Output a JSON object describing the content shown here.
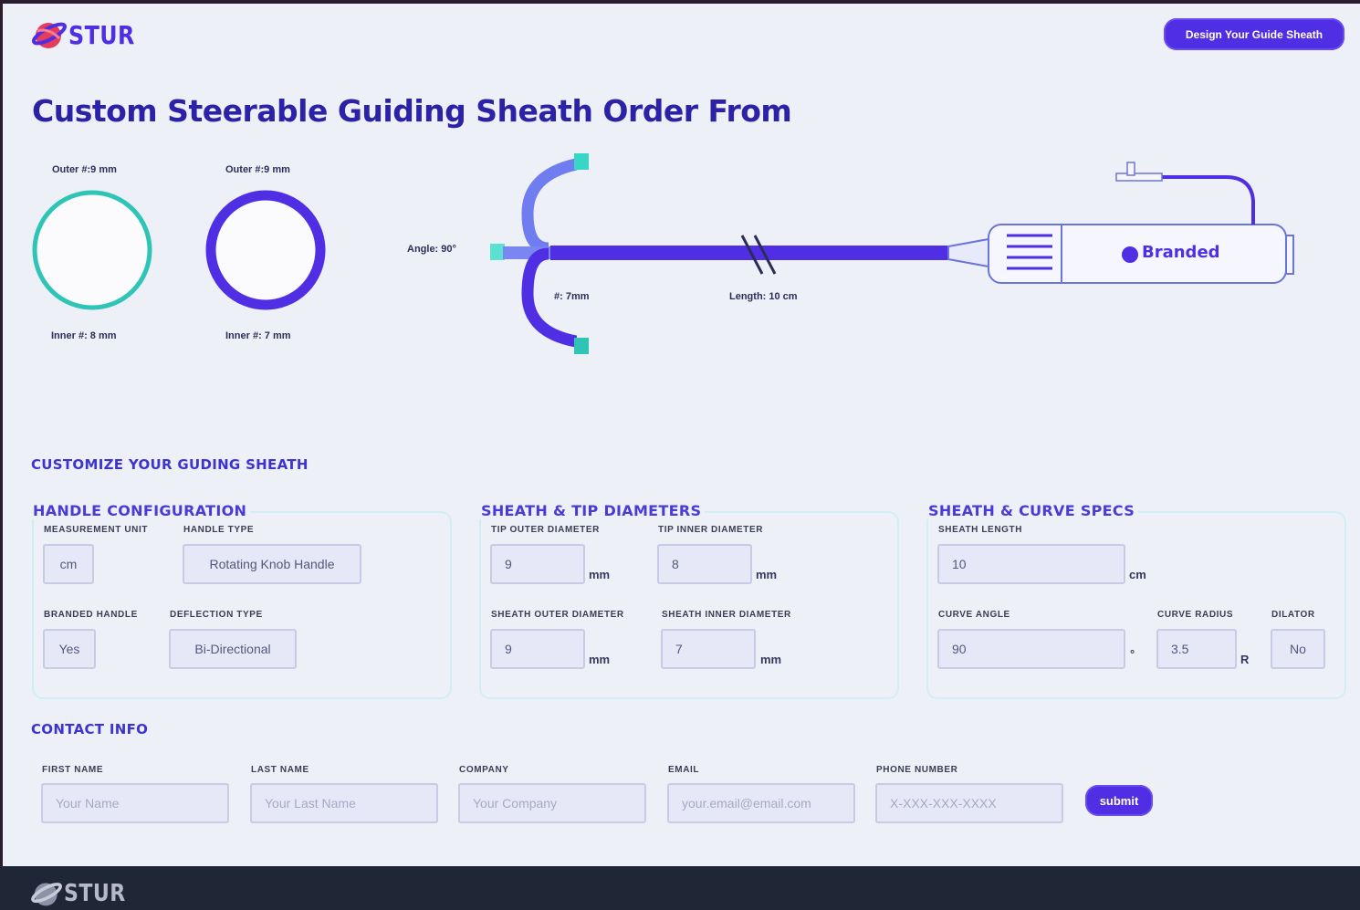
{
  "brand": {
    "name": "STUR",
    "colors": {
      "accent": "#4f2ee3",
      "title": "#2b22a8",
      "teal": "#2ec4b6",
      "footer": "#1f2636"
    }
  },
  "header": {
    "cta_label": "Design Your Guide Sheath"
  },
  "page_title": "Custom Steerable Guiding Sheath Order From",
  "diagram": {
    "ring1": {
      "outer": "Outer #:9 mm",
      "inner": "Inner #: 8 mm"
    },
    "ring2": {
      "outer": "Outer #:9 mm",
      "inner": "Inner #: 7 mm"
    },
    "angle": "Angle: 90°",
    "tip_diameter": "#: 7mm",
    "length": "Length: 10 cm",
    "handle_label": "Branded"
  },
  "customize_heading": "CUSTOMIZE YOUR GUDING SHEATH",
  "handle_config": {
    "title": "HANDLE CONFIGURATION",
    "measurement_unit": {
      "label": "MEASUREMENT UNIT",
      "value": "cm"
    },
    "handle_type": {
      "label": "HANDLE TYPE",
      "value": "Rotating Knob Handle"
    },
    "branded_handle": {
      "label": "BRANDED HANDLE",
      "value": "Yes"
    },
    "deflection_type": {
      "label": "DEFLECTION TYPE",
      "value": "Bi-Directional"
    }
  },
  "diameters": {
    "title": "SHEATH & TIP DIAMETERS",
    "tip_outer": {
      "label": "TIP OUTER DIAMETER",
      "value": "9",
      "unit": "mm"
    },
    "tip_inner": {
      "label": "TIP INNER DIAMETER",
      "value": "8",
      "unit": "mm"
    },
    "sheath_outer": {
      "label": "SHEATH OUTER DIAMETER",
      "value": "9",
      "unit": "mm"
    },
    "sheath_inner": {
      "label": "SHEATH INNER DIAMETER",
      "value": "7",
      "unit": "mm"
    }
  },
  "curve_specs": {
    "title": "SHEATH & CURVE SPECS",
    "sheath_length": {
      "label": "SHEATH LENGTH",
      "value": "10",
      "unit": "cm"
    },
    "curve_angle": {
      "label": "CURVE ANGLE",
      "value": "90",
      "unit": "°"
    },
    "curve_radius": {
      "label": "CURVE RADIUS",
      "value": "3.5",
      "unit": "R"
    },
    "dilator": {
      "label": "DILATOR",
      "value": "No"
    }
  },
  "contact": {
    "title": "CONTACT INFO",
    "first_name": {
      "label": "FIRST NAME",
      "placeholder": "Your Name"
    },
    "last_name": {
      "label": "LAST NAME",
      "placeholder": "Your Last Name"
    },
    "company": {
      "label": "COMPANY",
      "placeholder": "Your Company"
    },
    "email": {
      "label": "EMAIL",
      "placeholder": "your.email@email.com"
    },
    "phone": {
      "label": "PHONE NUMBER",
      "placeholder": "X-XXX-XXX-XXXX"
    },
    "submit_label": "submit"
  },
  "footer": {
    "brand": "STUR"
  }
}
